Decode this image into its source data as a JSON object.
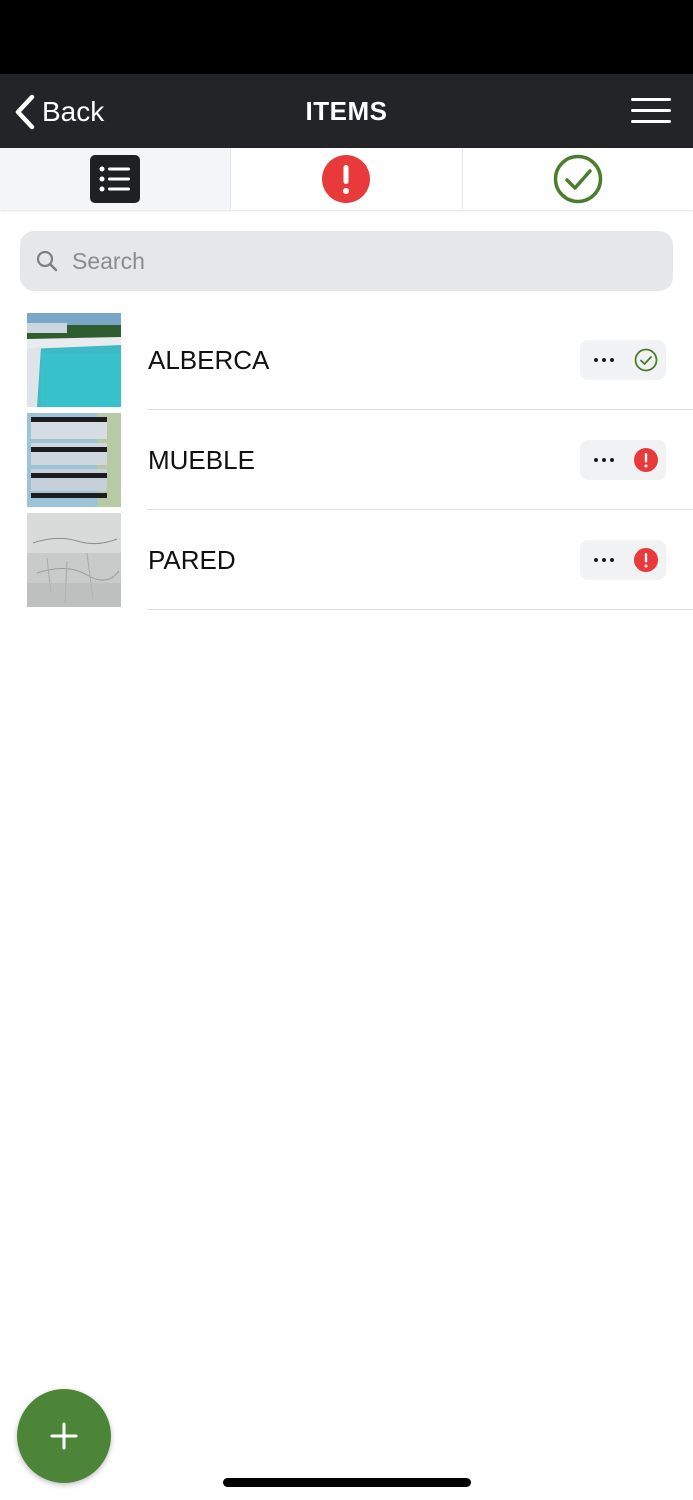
{
  "nav": {
    "back_label": "Back",
    "title": "ITEMS",
    "back_icon": "chevron-left-icon",
    "menu_icon": "hamburger-menu-icon"
  },
  "tabs": [
    {
      "icon": "list-icon",
      "active": true
    },
    {
      "icon": "alert-icon",
      "color": "#e83a3a"
    },
    {
      "icon": "check-circle-icon",
      "color": "#4a7d2c"
    }
  ],
  "search": {
    "placeholder": "Search",
    "value": ""
  },
  "items": [
    {
      "label": "ALBERCA",
      "status": "done",
      "thumbnail": "pool-photo"
    },
    {
      "label": "MUEBLE",
      "status": "issue",
      "thumbnail": "drawers-photo"
    },
    {
      "label": "PARED",
      "status": "issue",
      "thumbnail": "wall-photo"
    }
  ],
  "fab": {
    "icon": "plus-icon",
    "color": "#4c8438"
  },
  "colors": {
    "nav_bg": "#232428",
    "alert_red": "#e83a3a",
    "ok_green": "#4a7d2c"
  }
}
